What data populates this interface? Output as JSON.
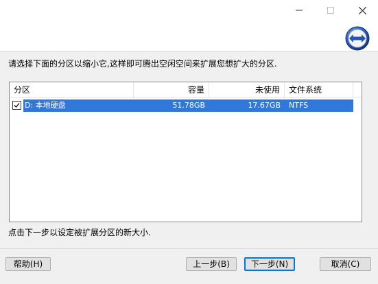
{
  "window": {
    "controls": [
      "minimize-icon",
      "maximize-icon",
      "close-icon"
    ]
  },
  "instruction": "请选择下面的分区以缩小它,这样即可腾出空闲空间来扩展您想扩大的分区.",
  "listview": {
    "columns": [
      "分区",
      "容量",
      "未使用",
      "文件系统"
    ],
    "rows": [
      {
        "checked": true,
        "partition": "D: 本地硬盘",
        "capacity": "51.78GB",
        "unused": "17.67GB",
        "fs": "NTFS"
      }
    ]
  },
  "hint": "点击下一步以设定被扩展分区的新大小.",
  "buttons": {
    "help": "帮助(H)",
    "back": "上一步(B)",
    "next": "下一步(N)",
    "cancel": "取消(C)"
  },
  "colors": {
    "selection": "#3178d8",
    "accent": "#0078d7"
  }
}
